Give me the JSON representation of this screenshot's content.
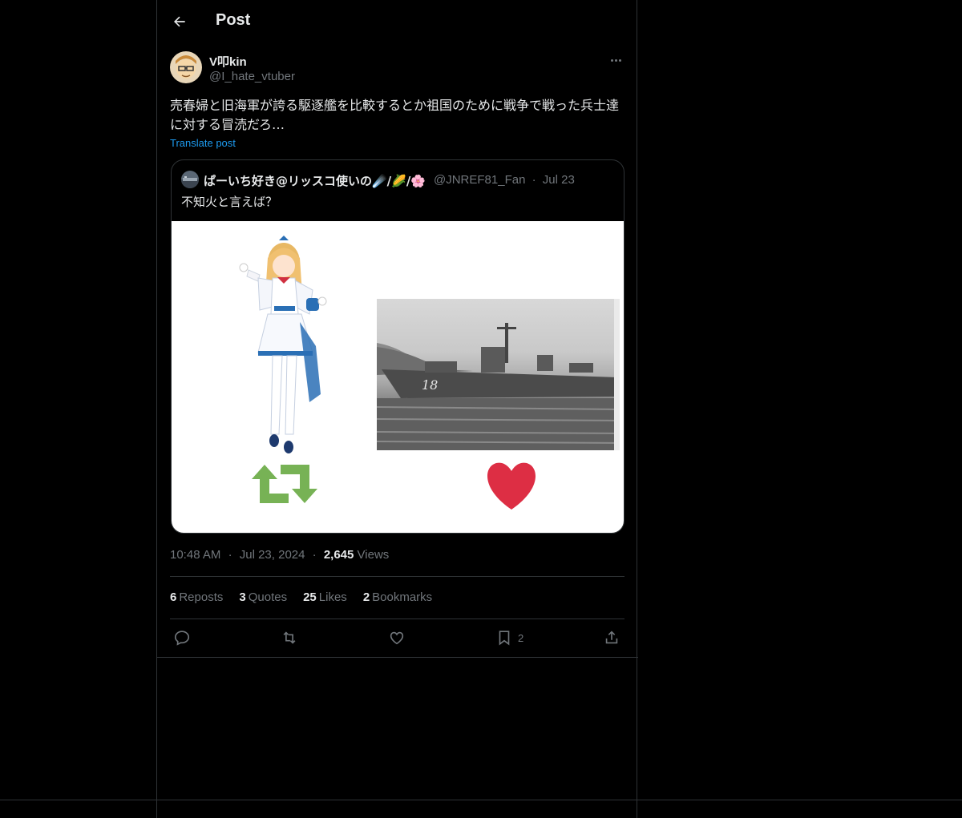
{
  "header": {
    "title": "Post"
  },
  "author": {
    "display_name": "V叩kin",
    "handle": "@I_hate_vtuber"
  },
  "post": {
    "text": "売春婦と旧海軍が誇る駆逐艦を比較するとか祖国のために戦争で戦った兵士達に対する冒涜だろ…",
    "translate_label": "Translate post"
  },
  "quote": {
    "display_name": "ぱーいち好き@リッスコ使いの☄️/🌽/🌸",
    "handle": "@JNREF81_Fan",
    "separator": "·",
    "date": "Jul 23",
    "text": "不知火と言えば？",
    "ship_number": "18"
  },
  "meta": {
    "time": "10:48 AM",
    "date": "Jul 23, 2024",
    "views_count": "2,645",
    "views_label": "Views",
    "sep": "·"
  },
  "stats": [
    {
      "count": "6",
      "label": "Reposts"
    },
    {
      "count": "3",
      "label": "Quotes"
    },
    {
      "count": "25",
      "label": "Likes"
    },
    {
      "count": "2",
      "label": "Bookmarks"
    }
  ],
  "actions": {
    "bookmark_count": "2"
  },
  "colors": {
    "background": "#000000",
    "border": "#2f3336",
    "text": "#e7e9ea",
    "muted": "#71767b",
    "link": "#1d9bf0",
    "retweet_green": "#77b255",
    "heart_red": "#dd2e44"
  }
}
